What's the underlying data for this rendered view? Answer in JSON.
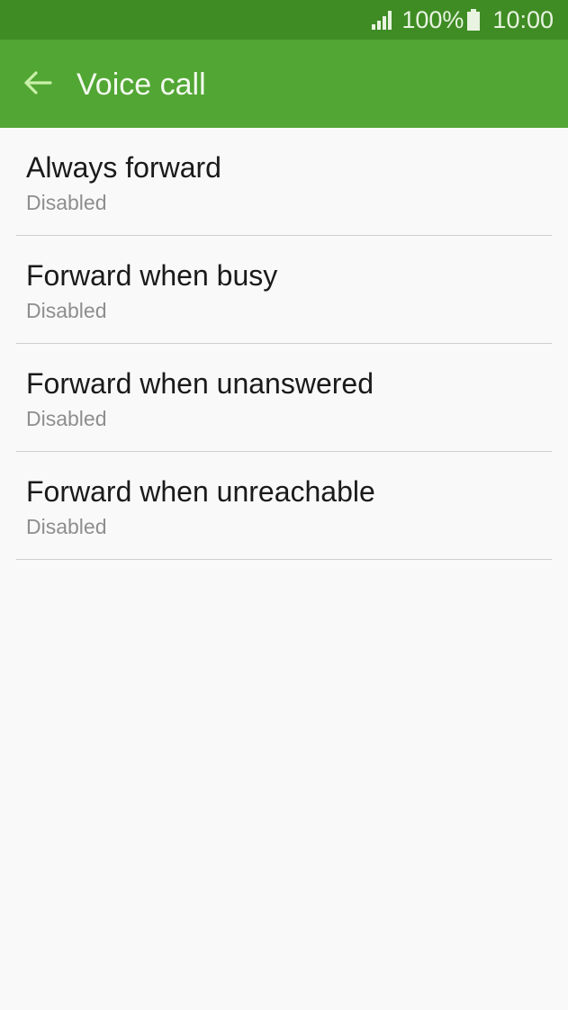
{
  "status_bar": {
    "signal_icon": "signal-icon",
    "battery_percent": "100%",
    "battery_icon": "battery-icon",
    "time": "10:00",
    "background": "#3f8c24"
  },
  "app_bar": {
    "back_icon": "arrow-left-icon",
    "title": "Voice call",
    "background": "#52a634",
    "back_icon_color": "#c8f0a8"
  },
  "items": [
    {
      "title": "Always forward",
      "status": "Disabled"
    },
    {
      "title": "Forward when busy",
      "status": "Disabled"
    },
    {
      "title": "Forward when unanswered",
      "status": "Disabled"
    },
    {
      "title": "Forward when unreachable",
      "status": "Disabled"
    }
  ]
}
